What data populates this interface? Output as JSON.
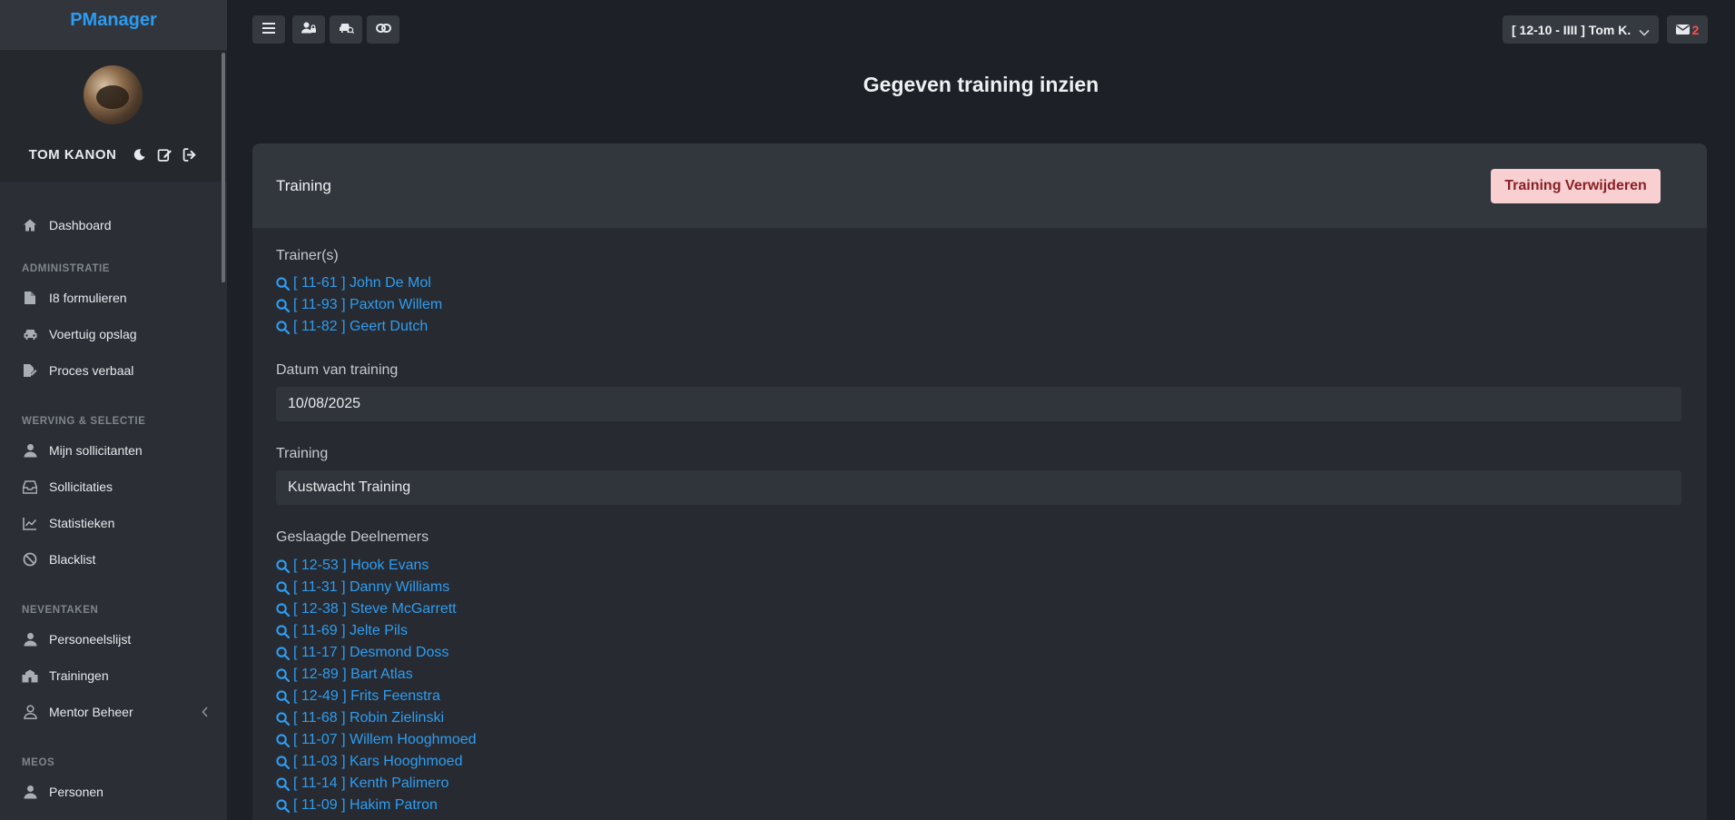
{
  "app": {
    "brand": "PManager"
  },
  "profile": {
    "name": "TOM KANON"
  },
  "sidebar": {
    "dashboard": "Dashboard",
    "sections": [
      {
        "header": "ADMINISTRATIE",
        "items": [
          "I8 formulieren",
          "Voertuig opslag",
          "Proces verbaal"
        ]
      },
      {
        "header": "WERVING & SELECTIE",
        "items": [
          "Mijn sollicitanten",
          "Sollicitaties",
          "Statistieken",
          "Blacklist"
        ]
      },
      {
        "header": "NEVENTAKEN",
        "items": [
          "Personeelslijst",
          "Trainingen",
          "Mentor Beheer"
        ]
      },
      {
        "header": "MEOS",
        "items": [
          "Personen"
        ]
      }
    ]
  },
  "topbar": {
    "user_label": "[ 12-10 - IIII ] Tom K.",
    "mail_count": "2"
  },
  "page": {
    "title": "Gegeven training inzien"
  },
  "card": {
    "title": "Training",
    "delete_button": "Training Verwijderen",
    "trainers_label": "Trainer(s)",
    "trainers": [
      "[ 11-61 ] John De Mol",
      "[ 11-93 ] Paxton Willem",
      "[ 11-82 ] Geert Dutch"
    ],
    "date_label": "Datum van training",
    "date_value": "10/08/2025",
    "training_label": "Training",
    "training_value": "Kustwacht Training",
    "participants_label": "Geslaagde Deelnemers",
    "participants": [
      "[ 12-53 ] Hook Evans",
      "[ 11-31 ] Danny Williams",
      "[ 12-38 ] Steve McGarrett",
      "[ 11-69 ] Jelte Pils",
      "[ 11-17 ] Desmond Doss",
      "[ 12-89 ] Bart Atlas",
      "[ 12-49 ] Frits Feenstra",
      "[ 11-68 ] Robin Zielinski",
      "[ 11-07 ] Willem Hooghmoed",
      "[ 11-03 ] Kars Hooghmoed",
      "[ 11-14 ] Kenth Palimero",
      "[ 11-09 ] Hakim Patron"
    ]
  },
  "colors": {
    "accent": "#2b9cf2",
    "danger_bg": "#f8d0d2",
    "danger_text": "#8a1f26",
    "badge": "#ff4d4d"
  }
}
